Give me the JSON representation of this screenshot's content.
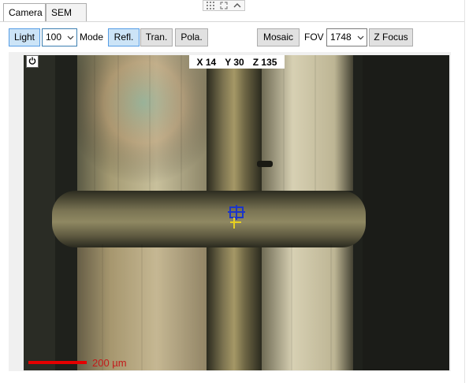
{
  "tabs": [
    {
      "label": "Camera",
      "active": true
    },
    {
      "label": "SEM",
      "active": false
    }
  ],
  "toolbar": {
    "light_label": "Light",
    "light_value": "100",
    "mode_label": "Mode",
    "mode_buttons": [
      "Refl.",
      "Tran.",
      "Pola."
    ],
    "mode_selected": "Refl.",
    "mosaic_label": "Mosaic",
    "fov_label": "FOV",
    "fov_value": "1748",
    "zfocus_label": "Z Focus"
  },
  "viewer": {
    "coords": {
      "x": "X 14",
      "y": "Y 30",
      "z": "Z 135"
    },
    "scale_label": "200 µm",
    "scale_color": "#e50000"
  },
  "icons": {
    "power": "power-icon",
    "grid": "grid-icon",
    "expand": "expand-icon",
    "collapse": "chevron-up-icon",
    "dropdown": "chevron-down-icon"
  }
}
